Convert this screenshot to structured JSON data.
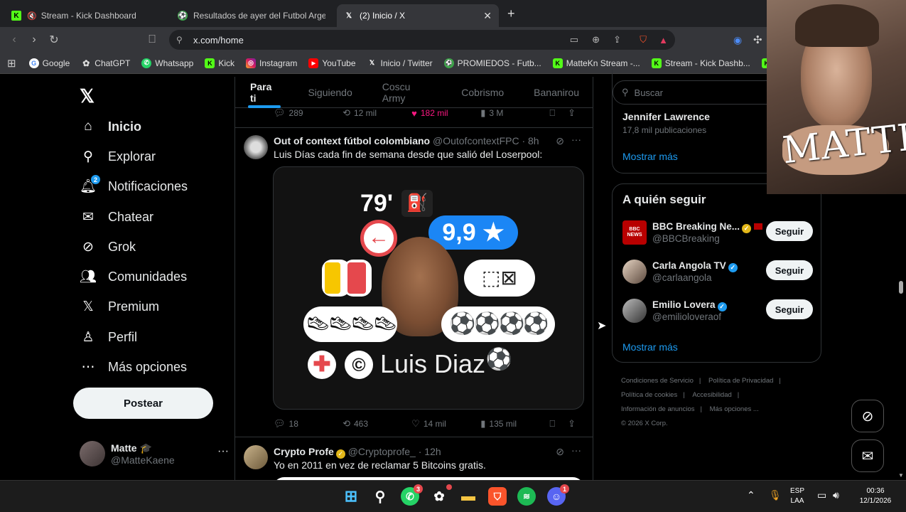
{
  "browser": {
    "tabs": [
      {
        "title": "Stream - Kick Dashboard",
        "favicon": "kick-icon",
        "active": false
      },
      {
        "title": "Resultados de ayer del Futbol Argent",
        "favicon": "promiedos-icon",
        "active": false
      },
      {
        "title": "(2) Inicio / X",
        "favicon": "x-icon",
        "active": true
      }
    ],
    "url": "x.com/home",
    "bookmarks": [
      "Google",
      "ChatGPT",
      "Whatsapp",
      "Kick",
      "Instagram",
      "YouTube",
      "Inicio / Twitter",
      "PROMIEDOS - Futb...",
      "MatteKn Stream -...",
      "Stream - Kick Dashb...",
      "L"
    ]
  },
  "nav": {
    "items": [
      {
        "label": "Inicio",
        "icon": "home-icon"
      },
      {
        "label": "Explorar",
        "icon": "search-icon"
      },
      {
        "label": "Notificaciones",
        "icon": "bell-icon",
        "badge": "2"
      },
      {
        "label": "Chatear",
        "icon": "mail-icon"
      },
      {
        "label": "Grok",
        "icon": "grok-icon"
      },
      {
        "label": "Comunidades",
        "icon": "people-icon"
      },
      {
        "label": "Premium",
        "icon": "x-premium-icon"
      },
      {
        "label": "Perfil",
        "icon": "person-icon"
      },
      {
        "label": "Más opciones",
        "icon": "more-circle-icon"
      }
    ],
    "post_label": "Postear",
    "account": {
      "name": "Matte 🎓",
      "handle": "@MatteKaene"
    }
  },
  "timeline": {
    "tabs": [
      "Para ti",
      "Siguiendo",
      "Coscu Army",
      "Cobrismo",
      "Bananirou"
    ],
    "prev_tweet_actions": {
      "replies": "289",
      "reposts": "12 mil",
      "likes": "182 mil",
      "views": "3 M"
    },
    "tweet1": {
      "name": "Out of context fútbol colombiano",
      "handle": "@OutofcontextFPC",
      "time": "· 8h",
      "text": "Luis Días cada fin de semana desde que salió del Loserpool:",
      "media": {
        "minute": "79'",
        "rating": "9,9 ★",
        "player": "Luis Diaz"
      },
      "replies": "18",
      "reposts": "463",
      "likes": "14 mil",
      "views": "135 mil"
    },
    "tweet2": {
      "name": "Crypto Profe",
      "handle": "@Cryptoprofe_",
      "time": "· 12h",
      "text": "Yo en 2011 en vez de reclamar 5 Bitcoins gratis."
    }
  },
  "sidebar": {
    "search_placeholder": "Buscar",
    "trend": {
      "name": "Jennifer Lawrence",
      "count": "17,8 mil publicaciones"
    },
    "show_more": "Mostrar más",
    "who_to_follow_title": "A quién seguir",
    "follow_label": "Seguir",
    "suggestions": [
      {
        "name": "BBC Breaking Ne...",
        "handle": "@BBCBreaking"
      },
      {
        "name": "Carla Angola TV",
        "handle": "@carlaangola"
      },
      {
        "name": "Emilio Lovera",
        "handle": "@emilioloveraof"
      }
    ],
    "footer": [
      "Condiciones de Servicio",
      "Política de Privacidad",
      "Política de cookies",
      "Accesibilidad",
      "Información de anuncios",
      "Más opciones ...",
      "© 2026 X Corp."
    ]
  },
  "webcam": {
    "overlay_text": "MATTE"
  },
  "taskbar": {
    "lang": "ESP",
    "region": "LAA",
    "time": "00:36",
    "date": "12/1/2026",
    "whatsapp_badge": "3",
    "discord_badge": "1"
  }
}
